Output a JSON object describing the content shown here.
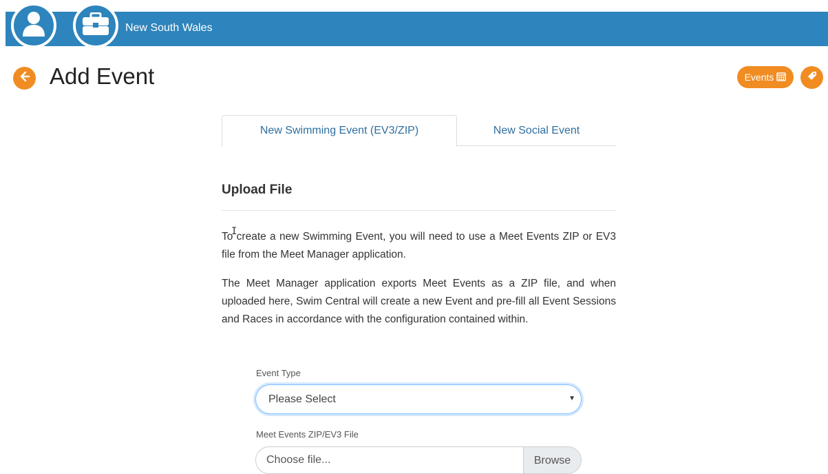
{
  "header": {
    "org_name": "New South Wales",
    "bar_color": "#2e84bc",
    "user_icon": "user-icon",
    "org_icon": "briefcase-icon"
  },
  "page": {
    "title": "Add Event",
    "back_icon": "arrow-left-icon",
    "events_button_label": "Events",
    "events_icon": "calendar-icon",
    "tag_icon": "tag-icon",
    "accent_color": "#f08c21"
  },
  "tabs": [
    {
      "label": "New Swimming Event (EV3/ZIP)",
      "active": true
    },
    {
      "label": "New Social Event",
      "active": false
    }
  ],
  "upload": {
    "section_title": "Upload File",
    "paragraph1": "To create a new Swimming Event, you will need to use a Meet Events ZIP or EV3 file from the Meet Manager application.",
    "paragraph2": "The Meet Manager application exports Meet Events as a ZIP file, and when uploaded here, Swim Central will create a new Event and pre-fill all Event Sessions and Races in accordance with the configuration contained within."
  },
  "form": {
    "event_type_label": "Event Type",
    "event_type_value": "Please Select",
    "file_label": "Meet Events ZIP/EV3 File",
    "file_placeholder": "Choose file...",
    "browse_label": "Browse"
  }
}
